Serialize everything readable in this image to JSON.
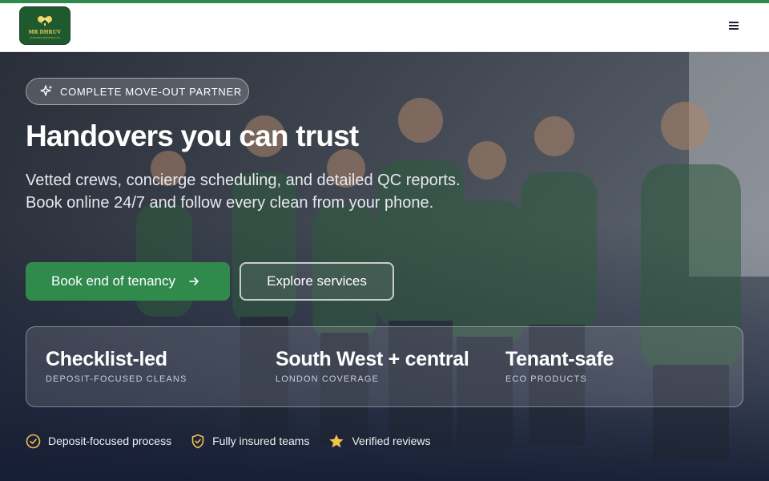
{
  "brand": {
    "name": "MR DHRUV",
    "tagline": "CLEANING SERVICES LTD",
    "accent": "#2f8a4c",
    "logo_bg": "#1f5a2f",
    "logo_ink": "#f4d35e"
  },
  "nav": {
    "menu_icon": "hamburger-icon"
  },
  "hero": {
    "badge": {
      "icon": "sparkle-icon",
      "label": "COMPLETE MOVE-OUT PARTNER"
    },
    "headline": "Handovers you can trust",
    "subtext": "Vetted crews, concierge scheduling, and detailed QC reports. Book online 24/7 and follow every clean from your phone.",
    "primary_cta": {
      "label": "Book end of tenancy",
      "icon": "arrow-right-icon"
    },
    "secondary_cta": {
      "label": "Explore services"
    }
  },
  "stats": [
    {
      "value": "Checklist-led",
      "label": "DEPOSIT-FOCUSED CLEANS"
    },
    {
      "value": "South West + central",
      "label": "LONDON COVERAGE"
    },
    {
      "value": "Tenant-safe",
      "label": "ECO PRODUCTS"
    }
  ],
  "trust": [
    {
      "icon": "check-circle-icon",
      "label": "Deposit-focused process",
      "color": "#f2c14e"
    },
    {
      "icon": "shield-check-icon",
      "label": "Fully insured teams",
      "color": "#f2c14e"
    },
    {
      "icon": "star-icon",
      "label": "Verified reviews",
      "color": "#f2c14e"
    }
  ]
}
